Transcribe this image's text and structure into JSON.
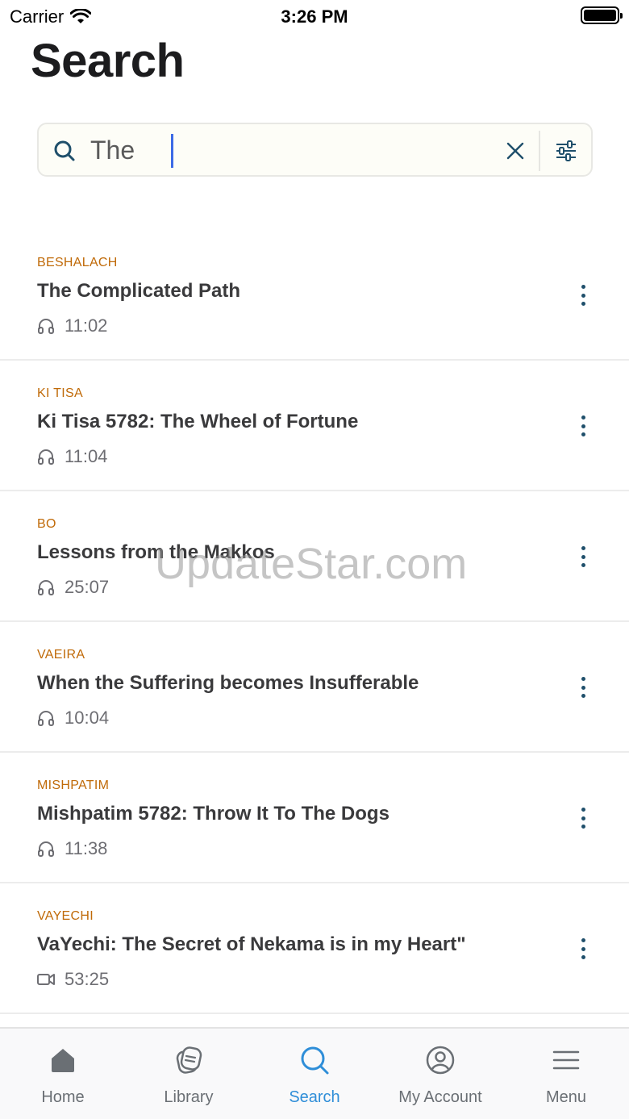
{
  "status_bar": {
    "carrier": "Carrier",
    "time": "3:26 PM"
  },
  "page": {
    "title": "Search"
  },
  "search": {
    "value": "The",
    "icon": "search-icon",
    "clear_icon": "close-icon",
    "filter_icon": "sliders-icon"
  },
  "results": [
    {
      "category": "BESHALACH",
      "title": "The Complicated Path",
      "media": "headphones-icon",
      "duration": "11:02"
    },
    {
      "category": "KI TISA",
      "title": "Ki Tisa 5782: The Wheel of Fortune",
      "media": "headphones-icon",
      "duration": "11:04"
    },
    {
      "category": "BO",
      "title": "Lessons from the Makkos",
      "media": "headphones-icon",
      "duration": "25:07"
    },
    {
      "category": "VAEIRA",
      "title": "When the Suffering becomes Insufferable",
      "media": "headphones-icon",
      "duration": "10:04"
    },
    {
      "category": "MISHPATIM",
      "title": "Mishpatim 5782: Throw It To The Dogs",
      "media": "headphones-icon",
      "duration": "11:38"
    },
    {
      "category": "VAYECHI",
      "title": "VaYechi: The Secret of Nekama is in my Heart\"",
      "media": "video-camera-icon",
      "duration": "53:25"
    }
  ],
  "watermark": "UpdateStar.com",
  "tabs": [
    {
      "label": "Home",
      "icon": "home-icon",
      "active": false
    },
    {
      "label": "Library",
      "icon": "library-icon",
      "active": false
    },
    {
      "label": "Search",
      "icon": "search-icon",
      "active": true
    },
    {
      "label": "My Account",
      "icon": "account-icon",
      "active": false
    },
    {
      "label": "Menu",
      "icon": "menu-icon",
      "active": false
    }
  ],
  "colors": {
    "category": "#c06a08",
    "accent": "#2f8ed8",
    "more_dots": "#1f4f6b",
    "caret": "#3d6be6"
  }
}
